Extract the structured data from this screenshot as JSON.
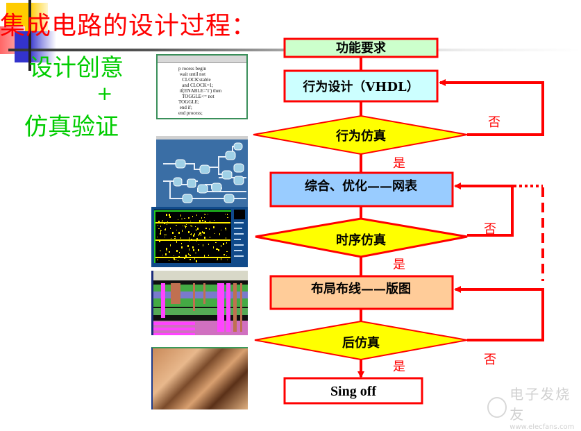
{
  "slide": {
    "title": "集成电路的设计过程：",
    "left_text": {
      "line1": "设计创意",
      "plus": "+",
      "line2": "仿真验证"
    },
    "colors": {
      "title": "#ff0000",
      "left_text": "#00cc00",
      "flow_line": "#ff0000",
      "decision_fill": "#ffff00"
    }
  },
  "illustrations": {
    "code_window": {
      "code_lines": [
        "p rocess begin",
        " wait until not",
        "   CLOCK'stable",
        "   and CLOCK=1;",
        " if(ENABLE='1') then",
        "   TOGGLE<= not",
        "TOGGLE;",
        " end if;",
        "end process;"
      ]
    },
    "schematic": "logic-gate-schematic",
    "layout_yellow": "placement-layout",
    "layout_color": "routing-layout",
    "chip_photo": "chip-micrograph"
  },
  "flowchart": {
    "nodes": [
      {
        "id": "n1",
        "type": "process",
        "label": "功能要求",
        "fill": "#ccffcc"
      },
      {
        "id": "n2",
        "type": "process",
        "label": "行为设计（VHDL）",
        "fill": "#ccffff"
      },
      {
        "id": "d1",
        "type": "decision",
        "label": "行为仿真",
        "fill": "#ffff00"
      },
      {
        "id": "n3",
        "type": "process",
        "label": "综合、优化——网表",
        "fill": "#99ccff"
      },
      {
        "id": "d2",
        "type": "decision",
        "label": "时序仿真",
        "fill": "#ffff00"
      },
      {
        "id": "n4",
        "type": "process",
        "label": "布局布线——版图",
        "fill": "#ffcc99"
      },
      {
        "id": "d3",
        "type": "decision",
        "label": "后仿真",
        "fill": "#ffff00"
      },
      {
        "id": "n5",
        "type": "process",
        "label": "Sing off",
        "fill": "#ffffff"
      }
    ],
    "edges": [
      {
        "from": "n1",
        "to": "n2",
        "label": ""
      },
      {
        "from": "n2",
        "to": "d1",
        "label": ""
      },
      {
        "from": "d1",
        "to": "n3",
        "label": "是"
      },
      {
        "from": "d1",
        "to": "n2",
        "label": "否"
      },
      {
        "from": "n3",
        "to": "d2",
        "label": ""
      },
      {
        "from": "d2",
        "to": "n4",
        "label": "是"
      },
      {
        "from": "d2",
        "to": "n3",
        "label": "否"
      },
      {
        "from": "n4",
        "to": "d3",
        "label": ""
      },
      {
        "from": "d3",
        "to": "n5",
        "label": "是"
      },
      {
        "from": "d3",
        "to": "n4",
        "label": "否"
      },
      {
        "from": "d3",
        "to": "n3",
        "label": "",
        "style": "dashed"
      }
    ],
    "labels": {
      "yes": "是",
      "no": "否"
    }
  },
  "watermark": {
    "name": "电子发烧友",
    "url": "www.elecfans.com"
  }
}
